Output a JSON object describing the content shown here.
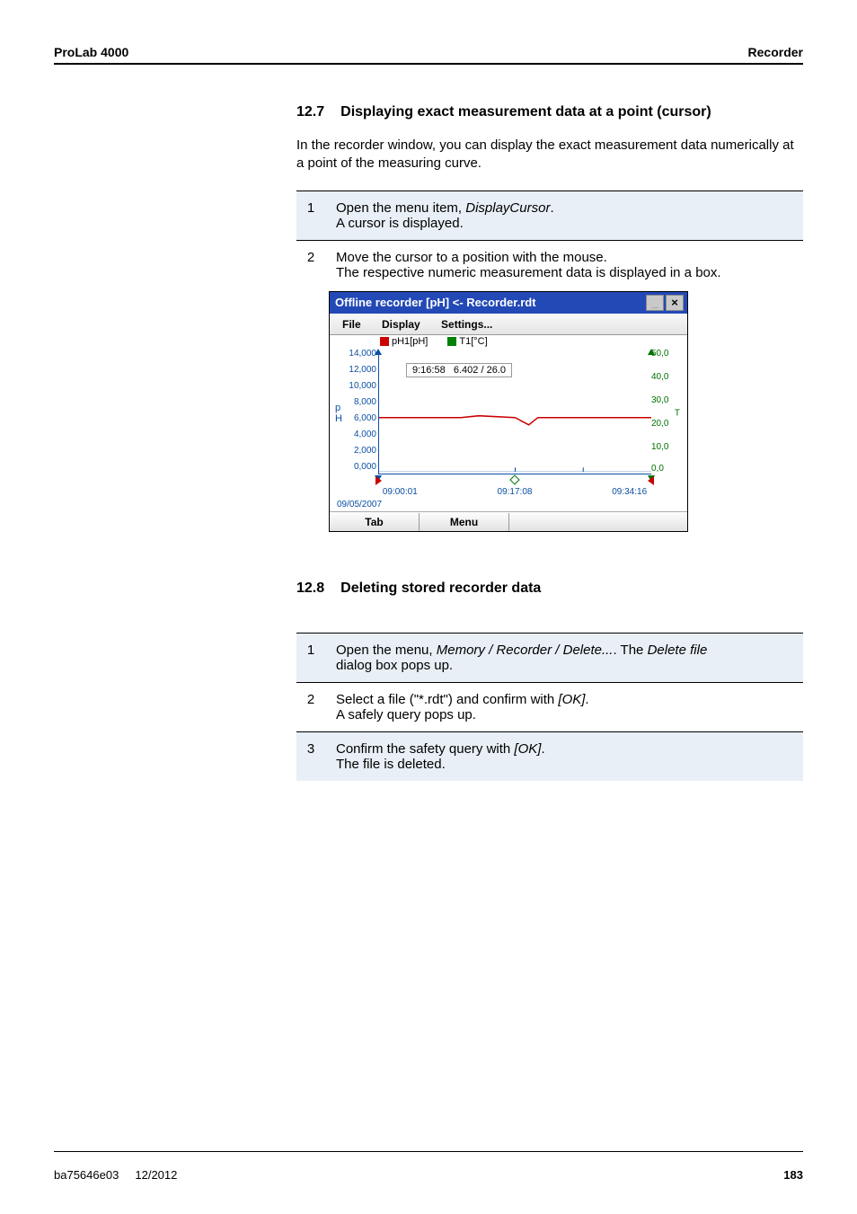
{
  "header": {
    "left": "ProLab 4000",
    "right": "Recorder"
  },
  "section1": {
    "num": "12.7",
    "title": "Displaying exact measurement data at a point (cursor)",
    "intro": "In the recorder window, you can display the exact measurement data numerically at a point of the measuring curve.",
    "steps": [
      {
        "n": "1",
        "pre": "Open the menu item, ",
        "em": "DisplayCursor",
        "post1": ".",
        "line2": "A cursor is displayed."
      },
      {
        "n": "2",
        "line1": "Move the cursor to a position with the mouse.",
        "line2": "The respective numeric measurement data is displayed in a box."
      }
    ]
  },
  "screenshot": {
    "title": "Offline recorder [pH] <- Recorder.rdt",
    "btn_min": "_",
    "btn_close": "×",
    "menus": {
      "file": "File",
      "display": "Display",
      "settings": "Settings..."
    },
    "legend": {
      "a": "pH1[pH]",
      "b": "T1[°C]"
    },
    "tooltip": {
      "time": "9:16:58",
      "vals": "6.402 / 26.0"
    },
    "left_ticks": [
      "14,000",
      "12,000",
      "10,000",
      "8,000",
      "6,000",
      "4,000",
      "2,000",
      "0,000"
    ],
    "left_label_top": "p",
    "left_label_bot": "H",
    "right_ticks": [
      "50,0",
      "40,0",
      "30,0",
      "20,0",
      "10,0",
      "0,0"
    ],
    "right_label": "T",
    "x_ticks": [
      "09:00:01",
      "09:17:08",
      "09:34:16"
    ],
    "date": "09/05/2007",
    "btn_tab": "Tab",
    "btn_menu": "Menu"
  },
  "section2": {
    "num": "12.8",
    "title": "Deleting stored recorder data",
    "steps": [
      {
        "n": "1",
        "pre": "Open the menu, ",
        "em1": "Memory / Recorder / Delete...",
        "mid": ". The ",
        "em2": "Delete file",
        "line2": "dialog box pops up."
      },
      {
        "n": "2",
        "pre": "Select a file (\"*.rdt\") and confirm with ",
        "em": "[OK]",
        "post": ".",
        "line2": "A safely query pops up."
      },
      {
        "n": "3",
        "pre": "Confirm the safety query with ",
        "em": "[OK]",
        "post": ".",
        "line2": "The file is deleted."
      }
    ]
  },
  "chart_data": {
    "type": "line",
    "title": "Offline recorder [pH] <- Recorder.rdt",
    "x_axis": {
      "type": "time",
      "ticks": [
        "09:00:01",
        "09:17:08",
        "09:34:16"
      ],
      "date": "09/05/2007"
    },
    "series": [
      {
        "name": "pH1[pH]",
        "axis": "left",
        "color": "#c00",
        "yrange": [
          0,
          14
        ],
        "points_approx": [
          [
            0,
            6.4
          ],
          [
            0.3,
            6.4
          ],
          [
            0.5,
            6.4
          ],
          [
            0.55,
            5.8
          ],
          [
            0.6,
            6.4
          ],
          [
            1,
            6.4
          ]
        ]
      },
      {
        "name": "T1[°C]",
        "axis": "right",
        "color": "#008000",
        "yrange": [
          0,
          50
        ],
        "points_approx": [
          [
            0,
            26
          ],
          [
            1,
            26
          ]
        ]
      }
    ],
    "cursor": {
      "time": "9:16:58",
      "values": [
        6.402,
        26.0
      ]
    }
  },
  "footer": {
    "left1": "ba75646e03",
    "left2": "12/2012",
    "right": "183"
  }
}
